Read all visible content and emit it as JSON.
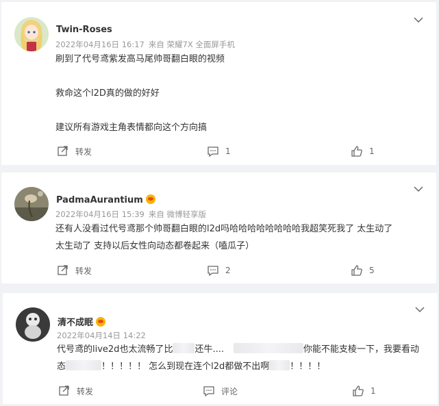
{
  "comments": [
    {
      "username": "Twin-Roses",
      "verified": false,
      "date": "2022年04月16日 16:17",
      "source": "来自 荣耀7X 全面屏手机",
      "lines": [
        "刷到了代号鸢紫发高马尾帅哥翻白眼的视频",
        "",
        "救命这个l2D真的做的好好",
        "",
        "建议所有游戏主角表情都向这个方向搞"
      ],
      "repost_label": "转发",
      "comment_count": "1",
      "like_count": "1"
    },
    {
      "username": "PadmaAurantium",
      "verified": true,
      "date": "2022年04月16日 15:39",
      "source": "来自 微博轻享版",
      "lines": [
        "还有人没看过代号鸢那个帅哥翻白眼的l2d吗哈哈哈哈哈哈哈哈我超笑死我了 太生动了",
        "太生动了 支持以后女性向动态都卷起来（嗑瓜子）"
      ],
      "repost_label": "转发",
      "comment_count": "2",
      "like_count": "5"
    },
    {
      "username": "清不成眠",
      "verified": true,
      "date": "2022年04月14日 14:22",
      "line1_a": "代号鸢的live2d也太流畅了比",
      "line1_b": "还牛....",
      "line1_c": "你能不能支棱一下，我要看动",
      "line2_a": "态",
      "line2_b": "！！！！！ 怎么到现在连个l2d都做不出啊",
      "line2_c": "！！！！",
      "repost_label": "转发",
      "comment_label": "评论",
      "like_count": "1"
    }
  ]
}
